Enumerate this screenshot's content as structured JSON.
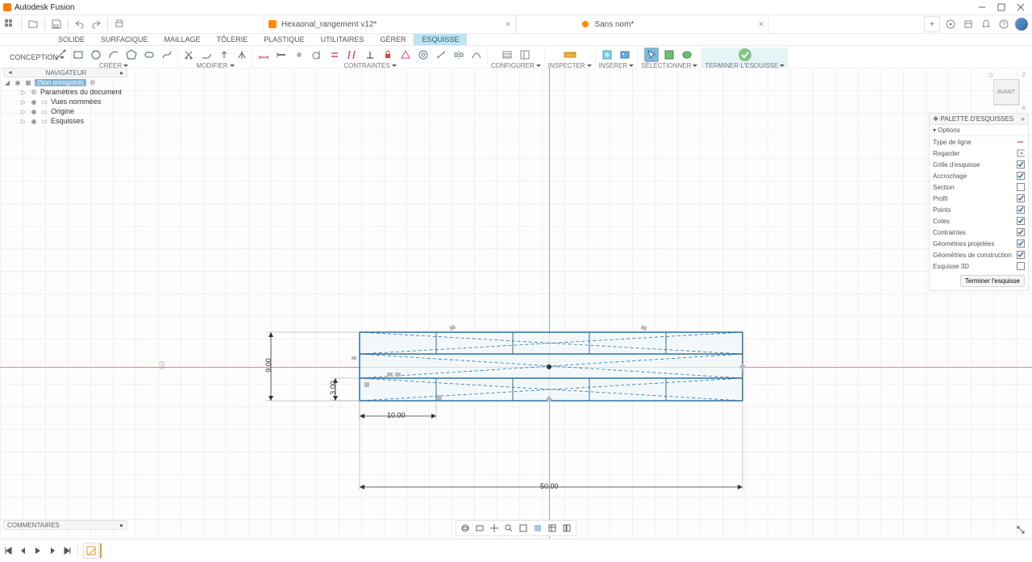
{
  "app_name": "Autodesk Fusion",
  "doc_tabs": [
    {
      "label": "Hexaonal_rangement v12*",
      "accent": "#ff8a00"
    },
    {
      "label": "Sans nom*",
      "accent": "#ff8a00"
    }
  ],
  "workspace": "CONCEPTION",
  "ribbon_tabs": [
    "SOLIDE",
    "SURFACIQUE",
    "MAILLAGE",
    "TÔLERIE",
    "PLASTIQUE",
    "UTILITAIRES",
    "GÉRER",
    "ESQUISSE"
  ],
  "ribbon_active": "ESQUISSE",
  "groups": {
    "create": "CRÉER",
    "modify": "MODIFIER",
    "constraints": "CONTRAINTES",
    "configure": "CONFIGURER",
    "inspect": "INSPECTER",
    "insert": "INSÉRER",
    "select": "SÉLECTIONNER",
    "finish": "TERMINER L'ESQUISSE"
  },
  "navigator": {
    "title": "NAVIGATEUR",
    "root": "(Non enregistré)",
    "nodes": [
      "Paramètres du document",
      "Vues nommées",
      "Origine",
      "Esquisses"
    ]
  },
  "viewcube": {
    "face": "AVANT",
    "axis1": "Z",
    "axis2": "X"
  },
  "palette": {
    "title": "PALETTE D'ESQUISSES",
    "section": "Options",
    "rows": [
      {
        "label": "Type de ligne",
        "kind": "linestyle"
      },
      {
        "label": "Regarder",
        "kind": "icon-eye"
      },
      {
        "label": "Grille d'esquisse",
        "kind": "check",
        "value": true
      },
      {
        "label": "Accrochage",
        "kind": "check",
        "value": true
      },
      {
        "label": "Section",
        "kind": "check",
        "value": false
      },
      {
        "label": "Profil",
        "kind": "check",
        "value": true
      },
      {
        "label": "Points",
        "kind": "check",
        "value": true
      },
      {
        "label": "Cotes",
        "kind": "check",
        "value": true
      },
      {
        "label": "Contraintes",
        "kind": "check",
        "value": true
      },
      {
        "label": "Géométries projetées",
        "kind": "check",
        "value": true
      },
      {
        "label": "Géométries de construction",
        "kind": "check",
        "value": true
      },
      {
        "label": "Esquisse 3D",
        "kind": "check",
        "value": false
      }
    ],
    "finish": "Terminer l'esquisse"
  },
  "dims": {
    "total_width": "50.00",
    "cell_width": "10.00",
    "half_height_a": "3.00",
    "height_total": "9.00",
    "left_ext": "50"
  },
  "comments": "COMMENTAIRES",
  "new_tab_plus": "+"
}
